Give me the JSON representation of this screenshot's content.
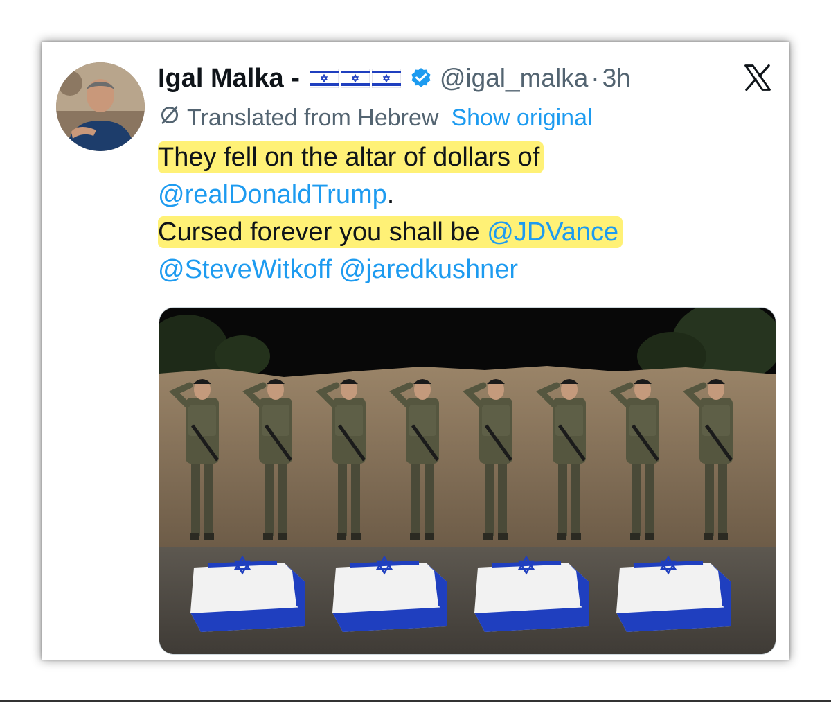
{
  "tweet": {
    "author_name": "Igal Malka -",
    "flags": [
      "israel-flag",
      "israel-flag",
      "israel-flag"
    ],
    "verified_icon": "verified-badge-icon",
    "handle": "@igal_malka",
    "separator": "·",
    "time": "3h",
    "platform_logo": "x-logo-icon",
    "translation": {
      "icon": "translate-slash-icon",
      "label": "Translated from Hebrew",
      "show_original": "Show original"
    },
    "text": {
      "line1": "They fell on the altar of dollars of",
      "mention_trump": "@realDonaldTrump",
      "period": ".",
      "line3_prefix": "Cursed forever you shall be",
      "mention_vance": "@JDVance",
      "mention_witkoff": "@SteveWitkoff",
      "mention_kushner": "@jaredkushner"
    },
    "media": {
      "soldier_count": 8,
      "coffin_count": 4
    }
  },
  "colors": {
    "link_blue": "#1d9bf0",
    "secondary_text": "#536471",
    "primary_text": "#0f1419",
    "highlight_yellow": "#fff176",
    "flag_blue": "#1f3fbf"
  }
}
